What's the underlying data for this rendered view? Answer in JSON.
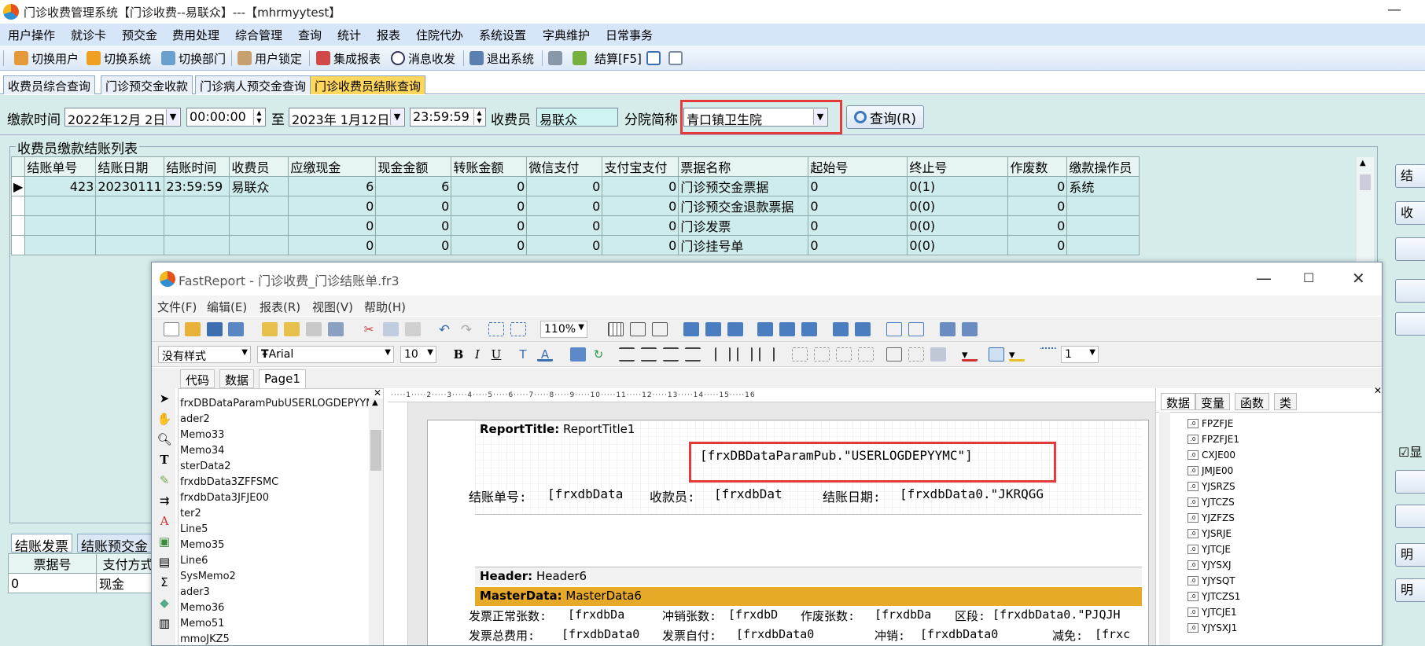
{
  "window": {
    "title": "门诊收费管理系统【门诊收费--易联众】---【mhrmyytest】",
    "minimize": "—"
  },
  "menu": [
    "用户操作",
    "就诊卡",
    "预交金",
    "费用处理",
    "综合管理",
    "查询",
    "统计",
    "报表",
    "住院代办",
    "系统设置",
    "字典维护",
    "日常事务"
  ],
  "toolbar": {
    "switch_user": "切换用户",
    "switch_system": "切换系统",
    "switch_dept": "切换部门",
    "user_lock": "用户锁定",
    "integrated_report": "集成报表",
    "message": "消息收发",
    "exit_system": "退出系统",
    "settle": "结算[F5]"
  },
  "tabs": [
    "收费员综合查询",
    "门诊预交金收款",
    "门诊病人预交金查询",
    "门诊收费员结账查询"
  ],
  "filter": {
    "pay_time_label": "缴款时间",
    "date_from": "2022年12月 2日",
    "time_from": "00:00:00",
    "to_label": "至",
    "date_to": "2023年 1月12日",
    "time_to": "23:59:59",
    "cashier_label": "收费员",
    "cashier_value": "易联众",
    "branch_label": "分院简称",
    "branch_value": "青口镇卫生院",
    "query_button": "查询(R)"
  },
  "list": {
    "title": "收费员缴款结账列表",
    "columns": [
      "结账单号",
      "结账日期",
      "结账时间",
      "收费员",
      "应缴现金",
      "现金金额",
      "转账金额",
      "微信支付",
      "支付宝支付",
      "票据名称",
      "起始号",
      "终止号",
      "作废数",
      "缴款操作员"
    ],
    "rows": [
      [
        "423",
        "20230111",
        "23:59:59",
        "易联众",
        "6",
        "6",
        "0",
        "0",
        "0",
        "门诊预交金票据",
        "0",
        "0(1)",
        "0",
        "系统"
      ],
      [
        "",
        "",
        "",
        "",
        "0",
        "0",
        "0",
        "0",
        "0",
        "门诊预交金退款票据",
        "0",
        "0(0)",
        "0",
        ""
      ],
      [
        "",
        "",
        "",
        "",
        "0",
        "0",
        "0",
        "0",
        "0",
        "门诊发票",
        "0",
        "0(0)",
        "0",
        ""
      ],
      [
        "",
        "",
        "",
        "",
        "0",
        "0",
        "0",
        "0",
        "0",
        "门诊挂号单",
        "0",
        "0(0)",
        "0",
        ""
      ]
    ]
  },
  "bottom": {
    "tabs": [
      "结账发票",
      "结账预交金"
    ],
    "columns": [
      "票据号",
      "支付方式"
    ],
    "row": [
      "0",
      "现金"
    ]
  },
  "right_buttons": [
    "结",
    "收",
    "",
    "",
    "",
    "显",
    "",
    "",
    "明",
    "明"
  ],
  "fastreport": {
    "title": "FastReport - 门诊收费_门诊结账单.fr3",
    "menu": [
      "文件(F)",
      "编辑(E)",
      "报表(R)",
      "视图(V)",
      "帮助(H)"
    ],
    "zoom": "110%",
    "style_combo": "没有样式",
    "font_combo": "Arial",
    "size_combo": "10",
    "line_width": "1",
    "tabs": [
      "代码",
      "数据",
      "Page1"
    ],
    "tree_items": [
      "frxDBDataParamPubUSERLOGDEPYYMC",
      "ader2",
      "Memo33",
      "Memo34",
      "sterData2",
      "frxdbData3ZFFSMC",
      "frxdbData3JFJE00",
      "ter2",
      "Line5",
      "Memo35",
      "Line6",
      "SysMemo2",
      "ader3",
      "Memo36",
      "Memo51",
      "mmoJKZ5"
    ],
    "ruler": "·····1·····2·····3·····4·····5·····6·····7·····8·····9·····10·····11·····12·····13·····14·····15·····16",
    "bands": {
      "report_title": "ReportTitle:",
      "report_title_name": "ReportTitle1",
      "header": "Header:",
      "header_name": "Header6",
      "master": "MasterData:",
      "master_name": "MasterData6"
    },
    "memo_top": "[frxDBDataParamPub.\"USERLOGDEPYYMC\"]",
    "memos_row1": [
      "结账单号:",
      "[frxdbData",
      "收款员:",
      "[frxdbDat",
      "结账日期:",
      "[frxdbData0.\"JKRQGG"
    ],
    "memos_row2": [
      "发票正常张数:",
      "[frxdbDa",
      "冲销张数:",
      "[frxdbD",
      "作废张数:",
      "[frxdbDa",
      "区段:",
      "[frxdbData0.\"PJQJH"
    ],
    "memos_row3": [
      "发票总费用:",
      "[frxdbData0",
      "发票自付:",
      "[frxdbData0",
      "冲销:",
      "[frxdbData0",
      "减免:",
      "[frxc"
    ],
    "data_tabs": [
      "数据",
      "变量",
      "函数",
      "类"
    ],
    "fields": [
      "FPZFJE",
      "FPZFJE1",
      "CXJE00",
      "JMJE00",
      "YJSRZS",
      "YJTCZS",
      "YJZFZS",
      "YJSRJE",
      "YJTCJE",
      "YJYSXJ",
      "YJYSQT",
      "YJTCZS1",
      "YJTCJE1",
      "YJYSXJ1"
    ]
  },
  "colors": {
    "accent_red": "#e53a3a",
    "active_tab": "#ffd75c",
    "panel": "#d5ecea",
    "master_band": "#e7a928"
  }
}
